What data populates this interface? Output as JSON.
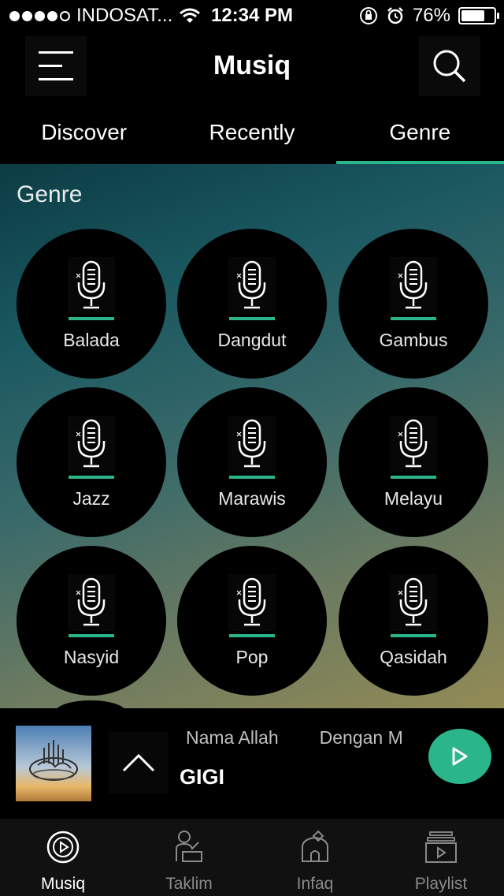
{
  "status_bar": {
    "carrier": "INDOSAT...",
    "time": "12:34 PM",
    "battery": "76%",
    "battery_fraction": 0.76
  },
  "header": {
    "title": "Musiq",
    "menu_icon": "hamburger-menu-icon",
    "search_icon": "search-icon"
  },
  "tabs": [
    {
      "label": "Discover",
      "active": false
    },
    {
      "label": "Recently",
      "active": false
    },
    {
      "label": "Genre",
      "active": true
    }
  ],
  "section": {
    "title": "Genre"
  },
  "genres": [
    {
      "label": "Balada",
      "icon": "microphone-icon"
    },
    {
      "label": "Dangdut",
      "icon": "microphone-icon"
    },
    {
      "label": "Gambus",
      "icon": "microphone-icon"
    },
    {
      "label": "Jazz",
      "icon": "microphone-icon"
    },
    {
      "label": "Marawis",
      "icon": "microphone-icon"
    },
    {
      "label": "Melayu",
      "icon": "microphone-icon"
    },
    {
      "label": "Nasyid",
      "icon": "microphone-icon"
    },
    {
      "label": "Pop",
      "icon": "microphone-icon"
    },
    {
      "label": "Qasidah",
      "icon": "microphone-icon"
    }
  ],
  "player": {
    "track_title": "Nama Allah",
    "track_next": "Dengan M",
    "artist": "GIGI",
    "expand_icon": "chevron-up-icon",
    "play_icon": "play-icon"
  },
  "bottom_nav": [
    {
      "label": "Musiq",
      "icon": "music-play-icon",
      "active": true
    },
    {
      "label": "Taklim",
      "icon": "teacher-icon",
      "active": false
    },
    {
      "label": "Infaq",
      "icon": "mosque-icon",
      "active": false
    },
    {
      "label": "Playlist",
      "icon": "playlist-icon",
      "active": false
    }
  ],
  "colors": {
    "accent": "#2bb58a",
    "background": "#000000"
  }
}
